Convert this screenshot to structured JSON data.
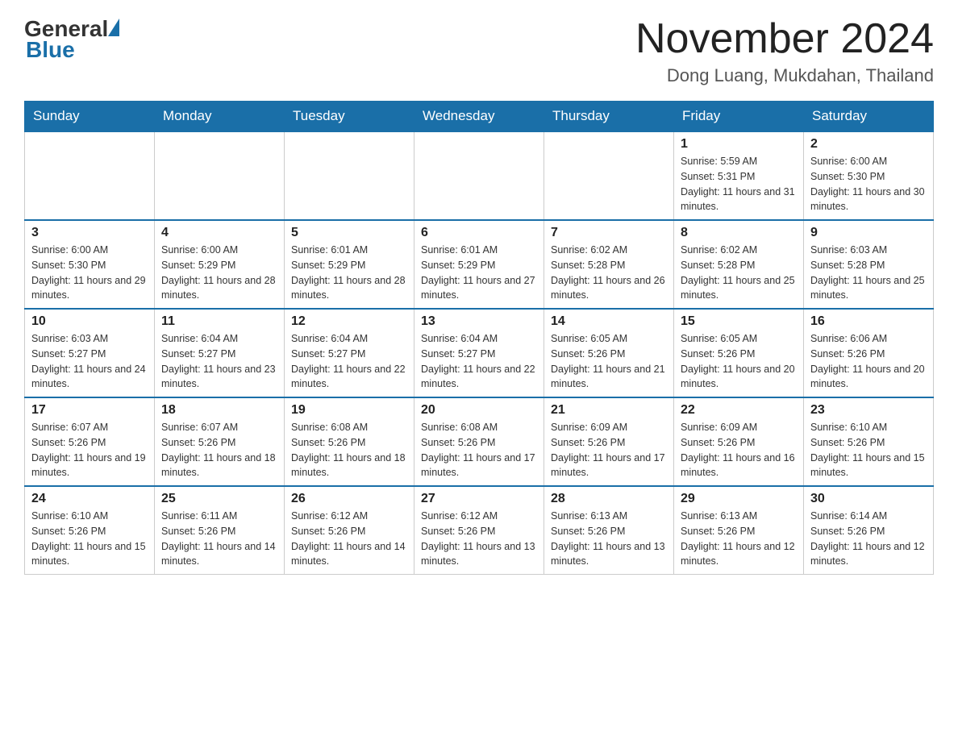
{
  "header": {
    "logo": {
      "general": "General",
      "blue": "Blue"
    },
    "title": "November 2024",
    "location": "Dong Luang, Mukdahan, Thailand"
  },
  "days_of_week": [
    "Sunday",
    "Monday",
    "Tuesday",
    "Wednesday",
    "Thursday",
    "Friday",
    "Saturday"
  ],
  "weeks": [
    [
      {
        "day": "",
        "info": ""
      },
      {
        "day": "",
        "info": ""
      },
      {
        "day": "",
        "info": ""
      },
      {
        "day": "",
        "info": ""
      },
      {
        "day": "",
        "info": ""
      },
      {
        "day": "1",
        "info": "Sunrise: 5:59 AM\nSunset: 5:31 PM\nDaylight: 11 hours and 31 minutes."
      },
      {
        "day": "2",
        "info": "Sunrise: 6:00 AM\nSunset: 5:30 PM\nDaylight: 11 hours and 30 minutes."
      }
    ],
    [
      {
        "day": "3",
        "info": "Sunrise: 6:00 AM\nSunset: 5:30 PM\nDaylight: 11 hours and 29 minutes."
      },
      {
        "day": "4",
        "info": "Sunrise: 6:00 AM\nSunset: 5:29 PM\nDaylight: 11 hours and 28 minutes."
      },
      {
        "day": "5",
        "info": "Sunrise: 6:01 AM\nSunset: 5:29 PM\nDaylight: 11 hours and 28 minutes."
      },
      {
        "day": "6",
        "info": "Sunrise: 6:01 AM\nSunset: 5:29 PM\nDaylight: 11 hours and 27 minutes."
      },
      {
        "day": "7",
        "info": "Sunrise: 6:02 AM\nSunset: 5:28 PM\nDaylight: 11 hours and 26 minutes."
      },
      {
        "day": "8",
        "info": "Sunrise: 6:02 AM\nSunset: 5:28 PM\nDaylight: 11 hours and 25 minutes."
      },
      {
        "day": "9",
        "info": "Sunrise: 6:03 AM\nSunset: 5:28 PM\nDaylight: 11 hours and 25 minutes."
      }
    ],
    [
      {
        "day": "10",
        "info": "Sunrise: 6:03 AM\nSunset: 5:27 PM\nDaylight: 11 hours and 24 minutes."
      },
      {
        "day": "11",
        "info": "Sunrise: 6:04 AM\nSunset: 5:27 PM\nDaylight: 11 hours and 23 minutes."
      },
      {
        "day": "12",
        "info": "Sunrise: 6:04 AM\nSunset: 5:27 PM\nDaylight: 11 hours and 22 minutes."
      },
      {
        "day": "13",
        "info": "Sunrise: 6:04 AM\nSunset: 5:27 PM\nDaylight: 11 hours and 22 minutes."
      },
      {
        "day": "14",
        "info": "Sunrise: 6:05 AM\nSunset: 5:26 PM\nDaylight: 11 hours and 21 minutes."
      },
      {
        "day": "15",
        "info": "Sunrise: 6:05 AM\nSunset: 5:26 PM\nDaylight: 11 hours and 20 minutes."
      },
      {
        "day": "16",
        "info": "Sunrise: 6:06 AM\nSunset: 5:26 PM\nDaylight: 11 hours and 20 minutes."
      }
    ],
    [
      {
        "day": "17",
        "info": "Sunrise: 6:07 AM\nSunset: 5:26 PM\nDaylight: 11 hours and 19 minutes."
      },
      {
        "day": "18",
        "info": "Sunrise: 6:07 AM\nSunset: 5:26 PM\nDaylight: 11 hours and 18 minutes."
      },
      {
        "day": "19",
        "info": "Sunrise: 6:08 AM\nSunset: 5:26 PM\nDaylight: 11 hours and 18 minutes."
      },
      {
        "day": "20",
        "info": "Sunrise: 6:08 AM\nSunset: 5:26 PM\nDaylight: 11 hours and 17 minutes."
      },
      {
        "day": "21",
        "info": "Sunrise: 6:09 AM\nSunset: 5:26 PM\nDaylight: 11 hours and 17 minutes."
      },
      {
        "day": "22",
        "info": "Sunrise: 6:09 AM\nSunset: 5:26 PM\nDaylight: 11 hours and 16 minutes."
      },
      {
        "day": "23",
        "info": "Sunrise: 6:10 AM\nSunset: 5:26 PM\nDaylight: 11 hours and 15 minutes."
      }
    ],
    [
      {
        "day": "24",
        "info": "Sunrise: 6:10 AM\nSunset: 5:26 PM\nDaylight: 11 hours and 15 minutes."
      },
      {
        "day": "25",
        "info": "Sunrise: 6:11 AM\nSunset: 5:26 PM\nDaylight: 11 hours and 14 minutes."
      },
      {
        "day": "26",
        "info": "Sunrise: 6:12 AM\nSunset: 5:26 PM\nDaylight: 11 hours and 14 minutes."
      },
      {
        "day": "27",
        "info": "Sunrise: 6:12 AM\nSunset: 5:26 PM\nDaylight: 11 hours and 13 minutes."
      },
      {
        "day": "28",
        "info": "Sunrise: 6:13 AM\nSunset: 5:26 PM\nDaylight: 11 hours and 13 minutes."
      },
      {
        "day": "29",
        "info": "Sunrise: 6:13 AM\nSunset: 5:26 PM\nDaylight: 11 hours and 12 minutes."
      },
      {
        "day": "30",
        "info": "Sunrise: 6:14 AM\nSunset: 5:26 PM\nDaylight: 11 hours and 12 minutes."
      }
    ]
  ]
}
